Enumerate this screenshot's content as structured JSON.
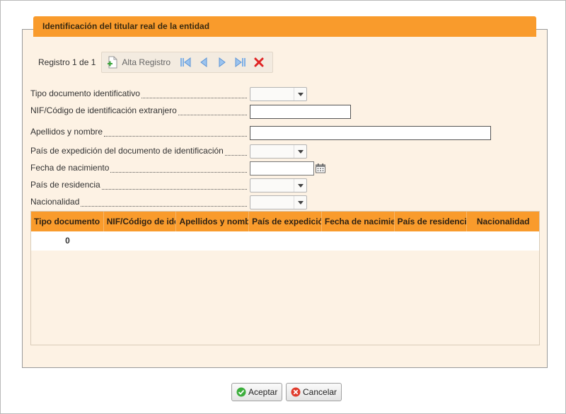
{
  "panel": {
    "title": "Identificación del titular real de la entidad"
  },
  "navbar": {
    "record_count": "Registro 1 de 1",
    "add_label": "Alta Registro"
  },
  "form": {
    "tipo_documento": "Tipo documento identificativo",
    "nif": "NIF/Código de identificación extranjero",
    "apellidos": "Apellidos y nombre",
    "pais_expedicion": "País de expedición del documento de identificación",
    "fecha_nacimiento": "Fecha de nacimiento",
    "pais_residencia": "País de residencia",
    "nacionalidad": "Nacionalidad"
  },
  "grid": {
    "headers": [
      "Tipo documento",
      "NIF/Código de identificación extranjero",
      "Apellidos y nombre",
      "País de expedición",
      "Fecha de nacimiento",
      "País de residencia",
      "Nacionalidad"
    ],
    "rows": [
      {
        "tipo_documento": "0"
      }
    ]
  },
  "buttons": {
    "accept": "Aceptar",
    "cancel": "Cancelar"
  },
  "colors": {
    "accent": "#f99b2c",
    "panel_bg": "#fdf2e4"
  }
}
